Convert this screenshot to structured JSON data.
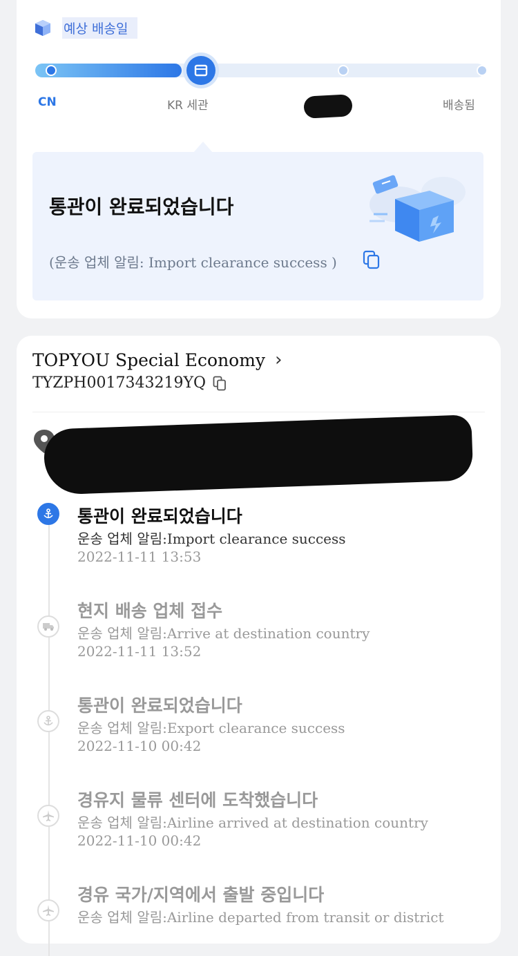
{
  "eta": {
    "label": "예상 배송일"
  },
  "progress": {
    "stages": [
      "CN",
      "KR 세관",
      "",
      "배송됨"
    ],
    "current_index": 1
  },
  "notice": {
    "title": "통관이 완료되었습니다",
    "subtitle": "(운송 업체 알림: Import clearance success )"
  },
  "carrier": {
    "name": "TOPYOU Special Economy",
    "tracking_number": "TYZPH0017343219YQ"
  },
  "events": [
    {
      "title": "통관이 완료되었습니다",
      "desc": "운송 업체 알림:Import clearance success",
      "time": "2022-11-11 13:53",
      "icon": "anchor-icon",
      "active": true
    },
    {
      "title": "현지 배송 업체 접수",
      "desc": "운송 업체 알림:Arrive at destination country",
      "time": "2022-11-11 13:52",
      "icon": "truck-icon",
      "active": false
    },
    {
      "title": "통관이 완료되었습니다",
      "desc": "운송 업체 알림:Export clearance success",
      "time": "2022-11-10 00:42",
      "icon": "anchor-icon",
      "active": false
    },
    {
      "title": "경유지 물류 센터에 도착했습니다",
      "desc": "운송 업체 알림:Airline arrived at destination country",
      "time": "2022-11-10 00:42",
      "icon": "airplane-icon",
      "active": false
    },
    {
      "title": "경유 국가/지역에서 출발 중입니다",
      "desc": "운송 업체 알림:Airline departed from transit or district",
      "time": "",
      "icon": "airplane-icon",
      "active": false
    }
  ],
  "colors": {
    "accent": "#2d77e6",
    "muted": "#999999",
    "background": "#f1f2f4"
  }
}
